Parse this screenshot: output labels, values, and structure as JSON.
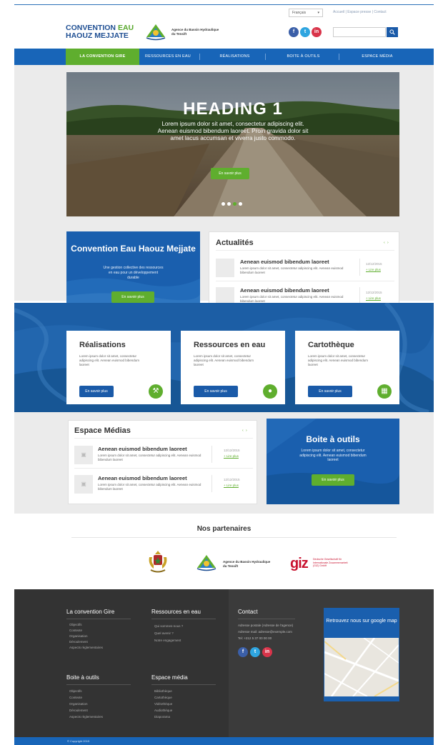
{
  "header": {
    "language": "Français",
    "top_links": "Accueil | Espace presse | Contact",
    "logo_line1_a": "CONVENTION",
    "logo_line1_b": "EAU",
    "logo_line2": "HAOUZ MEJJATE",
    "agency_name": "Agence du Bassin Hydraulique du Tensift",
    "social": [
      "f",
      "t",
      "in"
    ],
    "search_placeholder": ""
  },
  "nav": {
    "items": [
      "La convention Gire",
      "Ressources en eau",
      "Réalisations",
      "Boite à outils",
      "Espace média"
    ]
  },
  "hero": {
    "heading": "HEADING 1",
    "text": "Lorem ipsum dolor sit amet, consectetur adipiscing elit. Aenean euismod bibendum laoreet. Proin gravida dolor sit amet lacus accumsan et viverra justo commodo.",
    "button": "En savoir plus"
  },
  "convention": {
    "title": "Convention Eau Haouz Mejjate",
    "subtitle": "Une gestion collective des ressources en eau pour un développement durable",
    "button": "En savoir plus"
  },
  "actualites": {
    "title": "Actualités",
    "arrows": "‹ ›",
    "items": [
      {
        "title": "Aenean euismod bibendum laoreet",
        "text": "Lorem ipsum dolor sit amet, consectetur adipiscing elit. Aenean euismod bibendum laoreet",
        "date": "12/12/2015",
        "more": "+ Lire plus"
      },
      {
        "title": "Aenean euismod bibendum laoreet",
        "text": "Lorem ipsum dolor sit amet, consectetur adipiscing elit. Aenean euismod bibendum laoreet",
        "date": "12/12/2015",
        "more": "+ Lire plus"
      }
    ]
  },
  "features": [
    {
      "title": "Réalisations",
      "text": "Lorem ipsum dolor sit amet, consectetur adipiscing elit. Aenean euismod bibendum laoreet",
      "button": "En savoir plus",
      "icon": "tools-icon"
    },
    {
      "title": "Ressources en eau",
      "text": "Lorem ipsum dolor sit amet, consectetur adipiscing elit. Aenean euismod bibendum laoreet",
      "button": "En savoir plus",
      "icon": "water-drop-icon"
    },
    {
      "title": "Cartothèque",
      "text": "Lorem ipsum dolor sit amet, consectetur adipiscing elit. Aenean euismod bibendum laoreet",
      "button": "En savoir plus",
      "icon": "map-icon"
    }
  ],
  "medias": {
    "title": "Espace Médias",
    "arrows": "‹ ›",
    "items": [
      {
        "title": "Aenean euismod bibendum laoreet",
        "text": "Lorem ipsum dolor sit amet, consectetur adipiscing elit. Aenean euismod bibendum laoreet",
        "date": "12/12/2015",
        "more": "+ Lire plus"
      },
      {
        "title": "Aenean euismod bibendum laoreet",
        "text": "Lorem ipsum dolor sit amet, consectetur adipiscing elit. Aenean euismod bibendum laoreet",
        "date": "12/12/2015",
        "more": "+ Lire plus"
      }
    ]
  },
  "boite": {
    "title": "Boite à outils",
    "subtitle": "Lorem ipsum dolor sit amet, consectetur adipiscing elit. Aenean euismod bibendum laoreet",
    "button": "En savoir plus"
  },
  "partners": {
    "title": "Nos partenaires",
    "agency_name": "Agence du Bassin Hydraulique du Tensift",
    "giz": "giz",
    "giz_text": "Deutsche Gesellschaft für Internationale Zusammenarbeit (GIZ) GmbH"
  },
  "footer": {
    "col1_title": "La convention Gire",
    "col1_links": [
      "Objectifs",
      "Contexte",
      "Organisation",
      "Déroulement",
      "Aspects règlementaires"
    ],
    "col2_title": "Ressources en eau",
    "col2_links": [
      "Qui sommes-nous ?",
      "Quel avenir ?",
      "Notre engagement"
    ],
    "col3_title": "Contact",
    "contact_lines": [
      "Adresse postale (Adresse de l'agence)",
      "Adresse mail: adresse@exemple.com",
      "Tel: +212 5 37 00 00 00"
    ],
    "col4_title": "Boite à outils",
    "col4_links": [
      "Objectifs",
      "Contexte",
      "Organisation",
      "Déroulement",
      "Aspects règlementaires"
    ],
    "col5_title": "Espace média",
    "col5_links": [
      "Bibliothèque",
      "Cartothèque",
      "Vidéothèque",
      "Audiothèque",
      "Diaporama"
    ],
    "map_title": "Retrouvez nous sur google map",
    "copyright": "© Copyright 2015"
  },
  "colors": {
    "primary_blue": "#1865b8",
    "accent_green": "#5fae2e",
    "footer_dark": "#333333"
  }
}
